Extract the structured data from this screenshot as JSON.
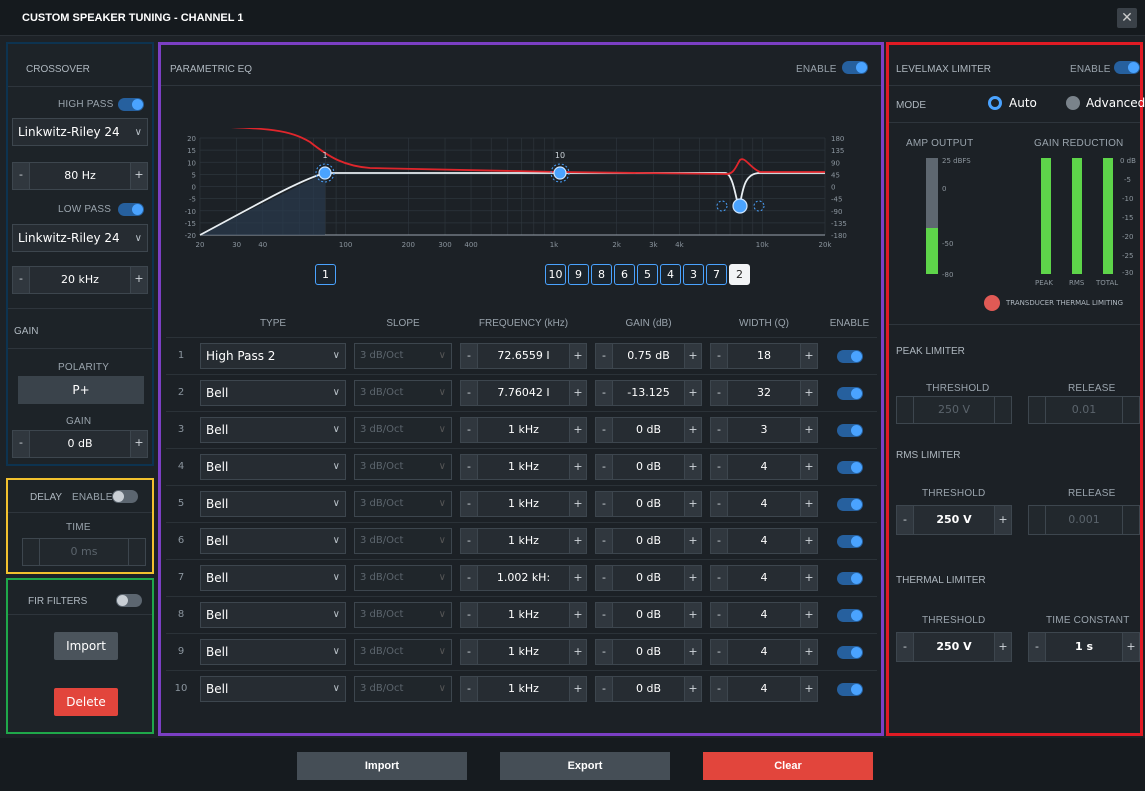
{
  "window": {
    "title": "CUSTOM SPEAKER TUNING - CHANNEL 1",
    "close_glyph": "✕"
  },
  "crossover": {
    "title": "CROSSOVER",
    "high_pass": {
      "label": "HIGH PASS",
      "enabled": true,
      "type": "Linkwitz-Riley 24",
      "freq": "80 Hz"
    },
    "low_pass": {
      "label": "LOW PASS",
      "enabled": true,
      "type": "Linkwitz-Riley 24",
      "freq": "20 kHz"
    }
  },
  "gain_section": {
    "title": "GAIN",
    "polarity_label": "POLARITY",
    "polarity": "P+",
    "gain_label": "GAIN",
    "gain": "0 dB"
  },
  "delay": {
    "title": "DELAY",
    "enable_label": "ENABLE",
    "enabled": false,
    "time_label": "TIME",
    "time": "0 ms"
  },
  "fir": {
    "title": "FIR FILTERS",
    "enabled": false,
    "import": "Import",
    "delete": "Delete"
  },
  "peq": {
    "title": "PARAMETRIC EQ",
    "enable_label": "ENABLE",
    "enabled": true,
    "graph": {
      "y_left_ticks": [
        "20",
        "15",
        "10",
        "5",
        "0",
        "-5",
        "-10",
        "-15",
        "-20"
      ],
      "y_right_ticks": [
        "180",
        "135",
        "90",
        "45",
        "0",
        "-45",
        "-90",
        "-135",
        "-180"
      ],
      "x_ticks": [
        "20",
        "30",
        "40",
        "100",
        "200",
        "300",
        "400",
        "1k",
        "2k",
        "3k",
        "4k",
        "10k",
        "20k"
      ],
      "band_markers": [
        "1",
        "10"
      ]
    },
    "band_buttons_left": [
      "1"
    ],
    "band_buttons_right": [
      "10",
      "9",
      "8",
      "6",
      "5",
      "4",
      "3",
      "7",
      "2"
    ],
    "active_band": "2",
    "columns": [
      "TYPE",
      "SLOPE",
      "FREQUENCY (kHz)",
      "GAIN (dB)",
      "WIDTH (Q)",
      "ENABLE"
    ],
    "rows": [
      {
        "n": "1",
        "type": "High Pass 2",
        "slope": "3 dB/Oct",
        "freq": "72.6559 I",
        "gain": "0.75 dB",
        "width": "18",
        "enabled": true
      },
      {
        "n": "2",
        "type": "Bell",
        "slope": "3 dB/Oct",
        "freq": "7.76042 I",
        "gain": "-13.125",
        "width": "32",
        "enabled": true
      },
      {
        "n": "3",
        "type": "Bell",
        "slope": "3 dB/Oct",
        "freq": "1 kHz",
        "gain": "0 dB",
        "width": "3",
        "enabled": true
      },
      {
        "n": "4",
        "type": "Bell",
        "slope": "3 dB/Oct",
        "freq": "1 kHz",
        "gain": "0 dB",
        "width": "4",
        "enabled": true
      },
      {
        "n": "5",
        "type": "Bell",
        "slope": "3 dB/Oct",
        "freq": "1 kHz",
        "gain": "0 dB",
        "width": "4",
        "enabled": true
      },
      {
        "n": "6",
        "type": "Bell",
        "slope": "3 dB/Oct",
        "freq": "1 kHz",
        "gain": "0 dB",
        "width": "4",
        "enabled": true
      },
      {
        "n": "7",
        "type": "Bell",
        "slope": "3 dB/Oct",
        "freq": "1.002 kH:",
        "gain": "0 dB",
        "width": "4",
        "enabled": true
      },
      {
        "n": "8",
        "type": "Bell",
        "slope": "3 dB/Oct",
        "freq": "1 kHz",
        "gain": "0 dB",
        "width": "4",
        "enabled": true
      },
      {
        "n": "9",
        "type": "Bell",
        "slope": "3 dB/Oct",
        "freq": "1 kHz",
        "gain": "0 dB",
        "width": "4",
        "enabled": true
      },
      {
        "n": "10",
        "type": "Bell",
        "slope": "3 dB/Oct",
        "freq": "1 kHz",
        "gain": "0 dB",
        "width": "4",
        "enabled": true
      }
    ]
  },
  "limiter": {
    "title": "LEVELMAX LIMITER",
    "enable_label": "ENABLE",
    "enabled": true,
    "mode_label": "MODE",
    "mode_auto": "Auto",
    "mode_advanced": "Advanced",
    "mode_selected": "Auto",
    "amp_output": {
      "title": "AMP OUTPUT",
      "scale": [
        "25 dBFS",
        "0",
        "-50",
        "-80"
      ]
    },
    "gain_reduction": {
      "title": "GAIN REDUCTION",
      "scale": [
        "0 dB",
        "-5",
        "-10",
        "-15",
        "-20",
        "-25",
        "-30"
      ],
      "labels": [
        "PEAK",
        "RMS",
        "TOTAL"
      ]
    },
    "thermal_indicator": "TRANSDUCER THERMAL LIMITING",
    "peak": {
      "title": "PEAK LIMITER",
      "threshold_label": "THRESHOLD",
      "threshold": "250 V",
      "release_label": "RELEASE",
      "release": "0.01"
    },
    "rms": {
      "title": "RMS LIMITER",
      "threshold_label": "THRESHOLD",
      "threshold": "250 V",
      "release_label": "RELEASE",
      "release": "0.001"
    },
    "thermal": {
      "title": "THERMAL LIMITER",
      "threshold_label": "THRESHOLD",
      "threshold": "250 V",
      "time_label": "TIME CONSTANT",
      "time": "1 s"
    }
  },
  "footer": {
    "import": "Import",
    "export": "Export",
    "clear": "Clear"
  },
  "colors": {
    "highlight_blue": "#0d3350",
    "highlight_yellow": "#f2c12e",
    "highlight_green": "#1fa84a",
    "highlight_purple": "#7b3fc4",
    "highlight_red": "#e01b24",
    "accent": "#4aa3ff",
    "clear": "#e2453c"
  }
}
